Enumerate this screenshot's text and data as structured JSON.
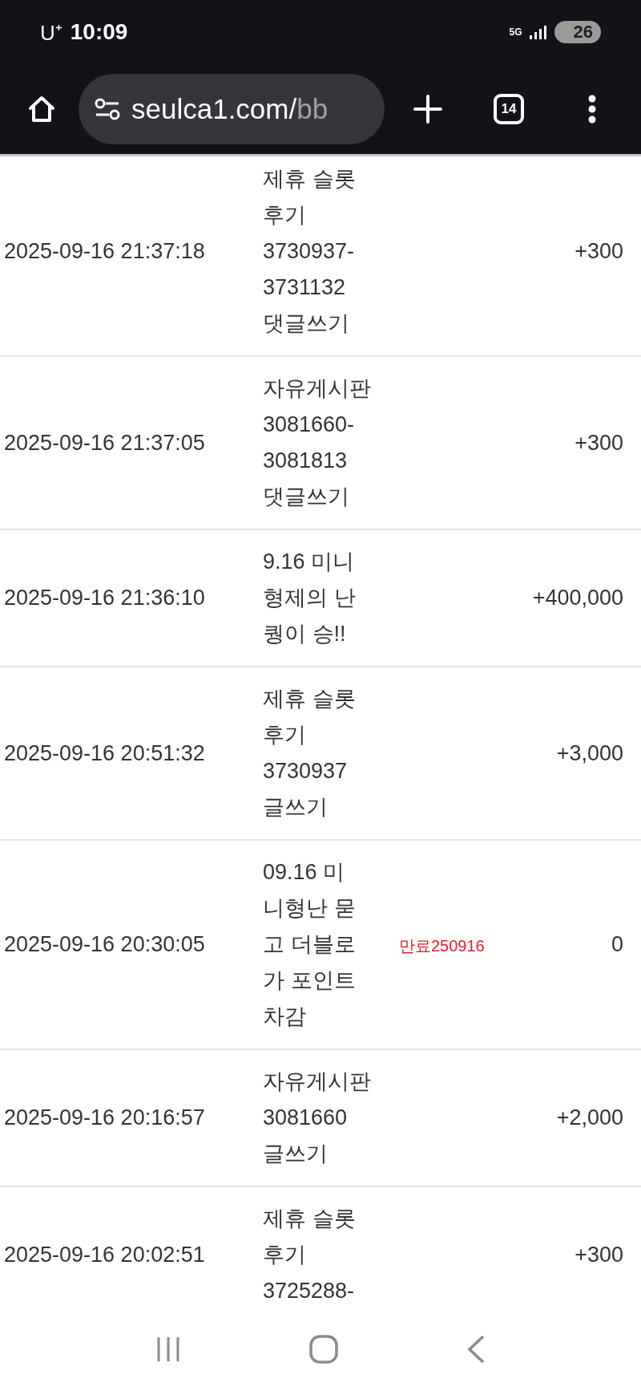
{
  "status_bar": {
    "carrier": "U⁺",
    "time": "10:09",
    "network": "5G",
    "battery": "26"
  },
  "browser": {
    "url_host": "seulca1.com/",
    "url_path": "bb",
    "tab_count": "14"
  },
  "rows": [
    {
      "datetime": "2025-09-16 21:37:18",
      "content": [
        "제휴 슬롯",
        "후기",
        "3730937-",
        "3731132",
        "댓글쓰기"
      ],
      "points": "+300"
    },
    {
      "datetime": "2025-09-16 21:37:05",
      "content": [
        "자유게시판",
        "3081660-",
        "3081813",
        "댓글쓰기"
      ],
      "points": "+300"
    },
    {
      "datetime": "2025-09-16 21:36:10",
      "content": [
        "9.16 미니",
        "형제의 난",
        "퀑이 승!!"
      ],
      "points": "+400,000"
    },
    {
      "datetime": "2025-09-16 20:51:32",
      "content": [
        "제휴 슬롯",
        "후기",
        "3730937",
        "글쓰기"
      ],
      "points": "+3,000"
    },
    {
      "datetime": "2025-09-16 20:30:05",
      "content": [
        "09.16 미",
        "니형난 묻",
        "고 더블로",
        "가 포인트",
        "차감"
      ],
      "note": "만료250916",
      "points": "0"
    },
    {
      "datetime": "2025-09-16 20:16:57",
      "content": [
        "자유게시판",
        "3081660",
        "글쓰기"
      ],
      "points": "+2,000"
    },
    {
      "datetime": "2025-09-16 20:02:51",
      "content": [
        "제휴 슬롯",
        "후기",
        "3725288-"
      ],
      "points": "+300"
    }
  ]
}
